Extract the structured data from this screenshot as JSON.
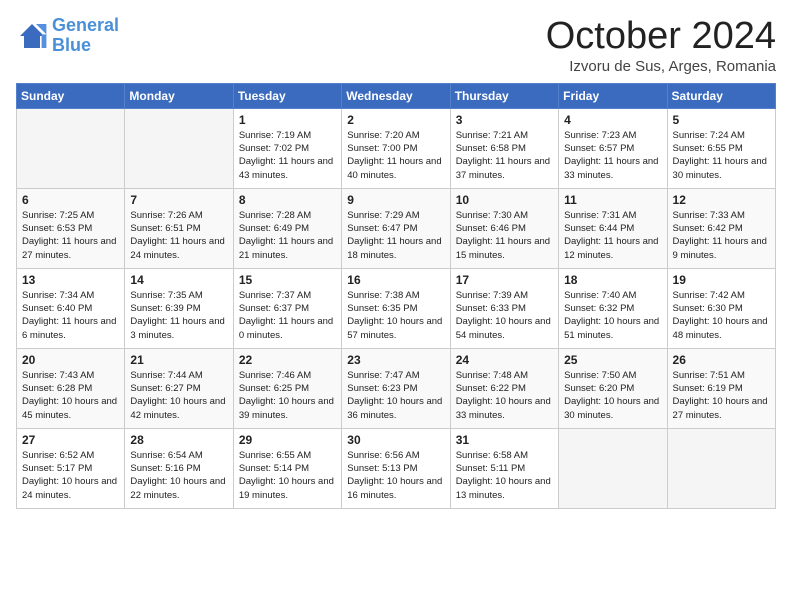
{
  "header": {
    "logo_line1": "General",
    "logo_line2": "Blue",
    "month_title": "October 2024",
    "subtitle": "Izvoru de Sus, Arges, Romania"
  },
  "days_of_week": [
    "Sunday",
    "Monday",
    "Tuesday",
    "Wednesday",
    "Thursday",
    "Friday",
    "Saturday"
  ],
  "weeks": [
    [
      {
        "day": "",
        "info": ""
      },
      {
        "day": "",
        "info": ""
      },
      {
        "day": "1",
        "info": "Sunrise: 7:19 AM\nSunset: 7:02 PM\nDaylight: 11 hours and 43 minutes."
      },
      {
        "day": "2",
        "info": "Sunrise: 7:20 AM\nSunset: 7:00 PM\nDaylight: 11 hours and 40 minutes."
      },
      {
        "day": "3",
        "info": "Sunrise: 7:21 AM\nSunset: 6:58 PM\nDaylight: 11 hours and 37 minutes."
      },
      {
        "day": "4",
        "info": "Sunrise: 7:23 AM\nSunset: 6:57 PM\nDaylight: 11 hours and 33 minutes."
      },
      {
        "day": "5",
        "info": "Sunrise: 7:24 AM\nSunset: 6:55 PM\nDaylight: 11 hours and 30 minutes."
      }
    ],
    [
      {
        "day": "6",
        "info": "Sunrise: 7:25 AM\nSunset: 6:53 PM\nDaylight: 11 hours and 27 minutes."
      },
      {
        "day": "7",
        "info": "Sunrise: 7:26 AM\nSunset: 6:51 PM\nDaylight: 11 hours and 24 minutes."
      },
      {
        "day": "8",
        "info": "Sunrise: 7:28 AM\nSunset: 6:49 PM\nDaylight: 11 hours and 21 minutes."
      },
      {
        "day": "9",
        "info": "Sunrise: 7:29 AM\nSunset: 6:47 PM\nDaylight: 11 hours and 18 minutes."
      },
      {
        "day": "10",
        "info": "Sunrise: 7:30 AM\nSunset: 6:46 PM\nDaylight: 11 hours and 15 minutes."
      },
      {
        "day": "11",
        "info": "Sunrise: 7:31 AM\nSunset: 6:44 PM\nDaylight: 11 hours and 12 minutes."
      },
      {
        "day": "12",
        "info": "Sunrise: 7:33 AM\nSunset: 6:42 PM\nDaylight: 11 hours and 9 minutes."
      }
    ],
    [
      {
        "day": "13",
        "info": "Sunrise: 7:34 AM\nSunset: 6:40 PM\nDaylight: 11 hours and 6 minutes."
      },
      {
        "day": "14",
        "info": "Sunrise: 7:35 AM\nSunset: 6:39 PM\nDaylight: 11 hours and 3 minutes."
      },
      {
        "day": "15",
        "info": "Sunrise: 7:37 AM\nSunset: 6:37 PM\nDaylight: 11 hours and 0 minutes."
      },
      {
        "day": "16",
        "info": "Sunrise: 7:38 AM\nSunset: 6:35 PM\nDaylight: 10 hours and 57 minutes."
      },
      {
        "day": "17",
        "info": "Sunrise: 7:39 AM\nSunset: 6:33 PM\nDaylight: 10 hours and 54 minutes."
      },
      {
        "day": "18",
        "info": "Sunrise: 7:40 AM\nSunset: 6:32 PM\nDaylight: 10 hours and 51 minutes."
      },
      {
        "day": "19",
        "info": "Sunrise: 7:42 AM\nSunset: 6:30 PM\nDaylight: 10 hours and 48 minutes."
      }
    ],
    [
      {
        "day": "20",
        "info": "Sunrise: 7:43 AM\nSunset: 6:28 PM\nDaylight: 10 hours and 45 minutes."
      },
      {
        "day": "21",
        "info": "Sunrise: 7:44 AM\nSunset: 6:27 PM\nDaylight: 10 hours and 42 minutes."
      },
      {
        "day": "22",
        "info": "Sunrise: 7:46 AM\nSunset: 6:25 PM\nDaylight: 10 hours and 39 minutes."
      },
      {
        "day": "23",
        "info": "Sunrise: 7:47 AM\nSunset: 6:23 PM\nDaylight: 10 hours and 36 minutes."
      },
      {
        "day": "24",
        "info": "Sunrise: 7:48 AM\nSunset: 6:22 PM\nDaylight: 10 hours and 33 minutes."
      },
      {
        "day": "25",
        "info": "Sunrise: 7:50 AM\nSunset: 6:20 PM\nDaylight: 10 hours and 30 minutes."
      },
      {
        "day": "26",
        "info": "Sunrise: 7:51 AM\nSunset: 6:19 PM\nDaylight: 10 hours and 27 minutes."
      }
    ],
    [
      {
        "day": "27",
        "info": "Sunrise: 6:52 AM\nSunset: 5:17 PM\nDaylight: 10 hours and 24 minutes."
      },
      {
        "day": "28",
        "info": "Sunrise: 6:54 AM\nSunset: 5:16 PM\nDaylight: 10 hours and 22 minutes."
      },
      {
        "day": "29",
        "info": "Sunrise: 6:55 AM\nSunset: 5:14 PM\nDaylight: 10 hours and 19 minutes."
      },
      {
        "day": "30",
        "info": "Sunrise: 6:56 AM\nSunset: 5:13 PM\nDaylight: 10 hours and 16 minutes."
      },
      {
        "day": "31",
        "info": "Sunrise: 6:58 AM\nSunset: 5:11 PM\nDaylight: 10 hours and 13 minutes."
      },
      {
        "day": "",
        "info": ""
      },
      {
        "day": "",
        "info": ""
      }
    ]
  ]
}
